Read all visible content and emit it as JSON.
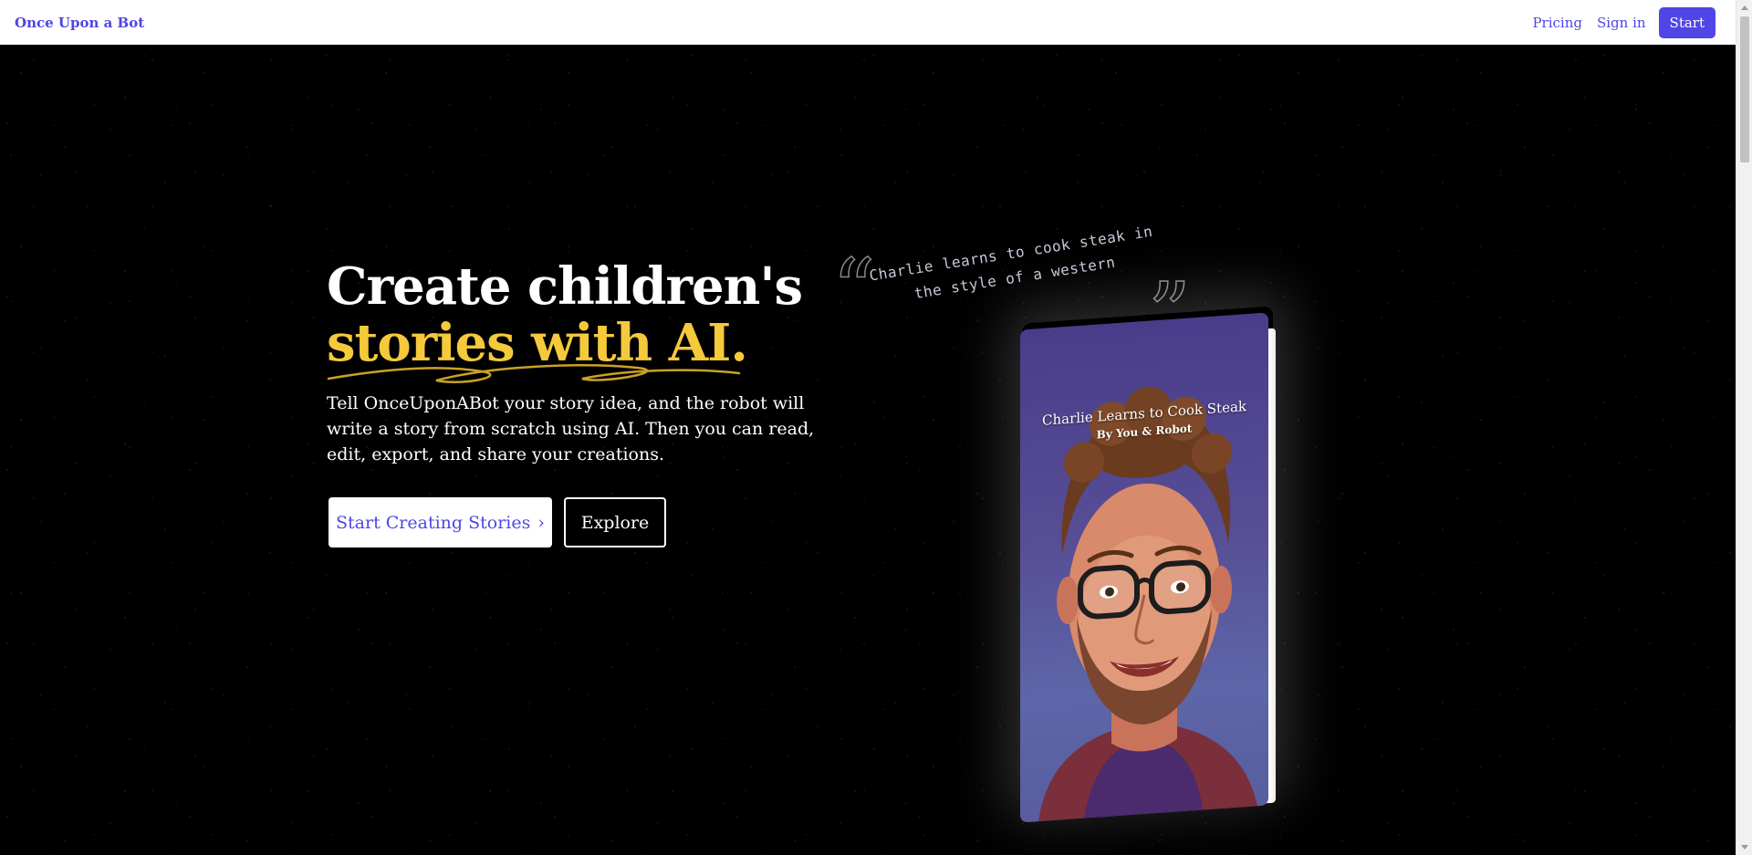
{
  "nav": {
    "brand": "Once Upon a Bot",
    "pricing": "Pricing",
    "sign_in": "Sign in",
    "start": "Start"
  },
  "hero": {
    "title_line1": "Create children's",
    "title_line2": "stories with AI.",
    "description": "Tell OnceUponABot your story idea, and the robot will write a story from scratch using AI. Then you can read, edit, export, and share your creations.",
    "primary_button": "Start Creating Stories",
    "primary_button_icon": "›",
    "secondary_button": "Explore"
  },
  "quote": {
    "open_mark": "“",
    "text": "Charlie learns to cook steak in the style of a western",
    "close_mark": "”"
  },
  "book": {
    "title": "Charlie Learns to Cook Steak",
    "author": "By You & Robot"
  },
  "colors": {
    "brand": "#4f46e5",
    "accent_yellow": "#f4c93c",
    "background": "#000000"
  }
}
